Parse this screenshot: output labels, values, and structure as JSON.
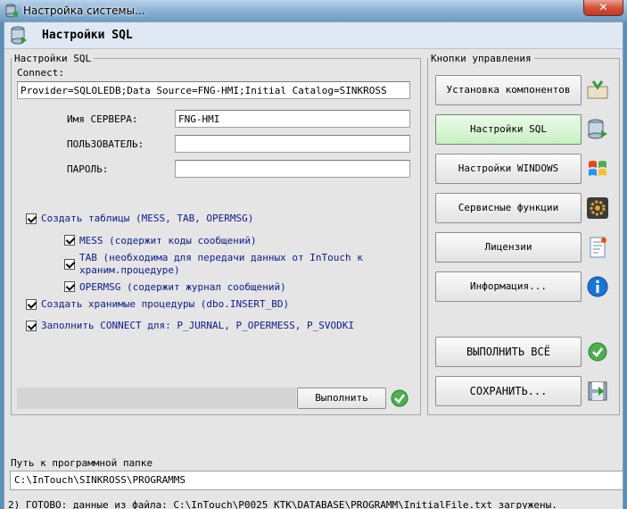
{
  "window": {
    "title": "Настройка системы..."
  },
  "header": {
    "title": "Настройки SQL"
  },
  "sql": {
    "legend": "Настройки SQL",
    "connect_label": "Connect:",
    "connect_value": "Provider=SQLOLEDB;Data Source=FNG-HMI;Initial Catalog=SINKROSS",
    "server_label": "Имя СЕРВЕРА:",
    "server_value": "FNG-HMI",
    "user_label": "ПОЛЬЗОВАТЕЛЬ:",
    "user_value": "",
    "password_label": "ПАРОЛЬ:",
    "password_value": "",
    "options": {
      "create_tables": "Создать таблицы (MESS, TAB, OPERMSG)",
      "mess": "MESS (содержит коды сообщений)",
      "tab_line1": "TAB (необходима для передачи данных от InTouch к",
      "tab_line2": "храним.процедуре)",
      "opermsg": "OPERMSG (содержит журнал сообщений)",
      "create_procs": "Создать хранимые процедуры (dbo.INSERT_BD)",
      "fill_connect": "Заполнить CONNECT для: P_JURNAL, P_OPERMESS, P_SVODKI"
    },
    "run_label": "Выполнить"
  },
  "controls": {
    "legend": "Кнопки управления",
    "install": "Установка компонентов",
    "sql_settings": "Настройки SQL",
    "windows_settings": "Настройки WINDOWS",
    "service": "Сервисные функции",
    "licenses": "Лицензии",
    "info": "Информация...",
    "run_all": "ВЫПОЛНИТЬ ВСЁ",
    "save": "СОХРАНИТЬ..."
  },
  "path": {
    "label": "Путь к программной папке",
    "value": "C:\\InTouch\\SINKROSS\\PROGRAMMS"
  },
  "status": "2)    ГОТОВО: данные из файла: C:\\InTouch\\P0025_KTK\\DATABASE\\PROGRAMM\\InitialFile.txt загружены.",
  "colors": {
    "accent_green": "#4caf50",
    "option_text": "#0c1a8e",
    "active_button": "#c9f0c4"
  }
}
